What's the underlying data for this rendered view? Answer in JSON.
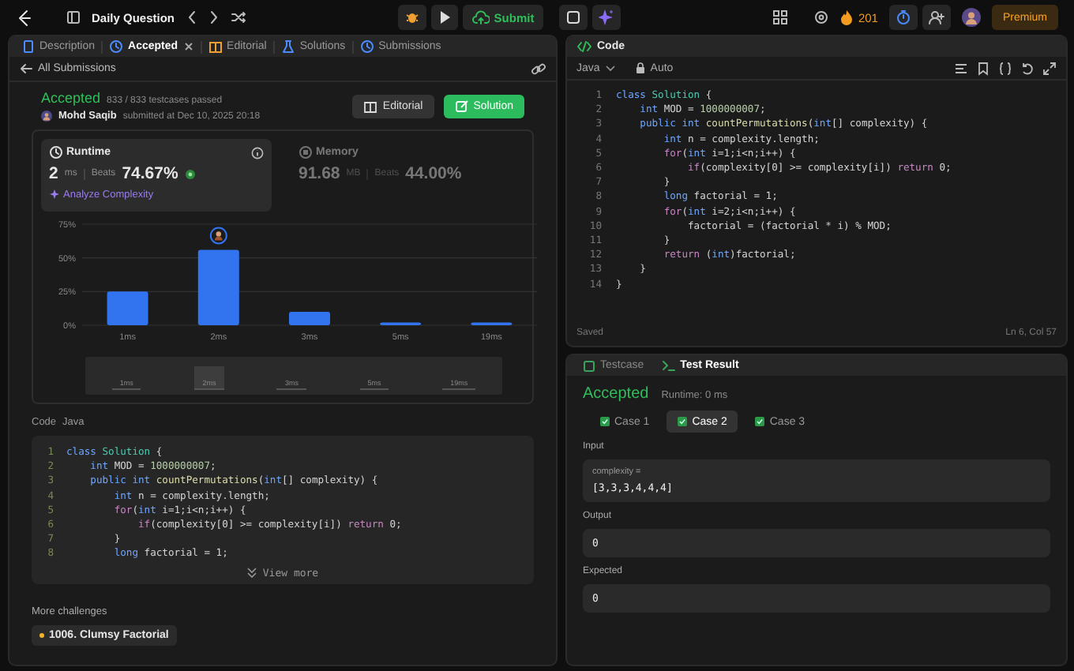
{
  "top_bar": {
    "title": "Daily Question",
    "submit": "Submit",
    "streak": "201",
    "premium": "Premium"
  },
  "tabs": [
    {
      "label": "Description",
      "kind": "description",
      "selected": false,
      "closable": false
    },
    {
      "label": "Accepted",
      "kind": "accepted",
      "selected": true,
      "closable": true
    },
    {
      "label": "Editorial",
      "kind": "editorial",
      "selected": false,
      "closable": false
    },
    {
      "label": "Solutions",
      "kind": "solutions",
      "selected": false,
      "closable": false
    },
    {
      "label": "Submissions",
      "kind": "submissions",
      "selected": false,
      "closable": false
    }
  ],
  "back_link": "All Submissions",
  "submission": {
    "status": "Accepted",
    "testcases": "833 / 833 testcases passed",
    "user": "Mohd Saqib",
    "submitted": "submitted at Dec 10, 2025 20:18",
    "buttons": [
      {
        "label": "Editorial",
        "kind": "secondary"
      },
      {
        "label": "Solution",
        "kind": "primary"
      }
    ]
  },
  "stats": [
    {
      "kind": "runtime",
      "title": "Runtime",
      "value": "2",
      "unit": "ms",
      "beats_label": "Beats",
      "beats": "74.67%",
      "selected": true,
      "link": "Analyze Complexity"
    },
    {
      "kind": "memory",
      "title": "Memory",
      "value": "91.68",
      "unit": "MB",
      "beats_label": "Beats",
      "beats": "44.00%",
      "selected": false
    }
  ],
  "runtime_chart": {
    "chart_data": {
      "type": "bar",
      "categories": [
        "1ms",
        "2ms",
        "3ms",
        "5ms",
        "19ms"
      ],
      "values": [
        25,
        56,
        10,
        2,
        2
      ],
      "ylim": [
        0,
        75
      ],
      "yticks": [
        {
          "value": 0,
          "label": "0%"
        },
        {
          "value": 25,
          "label": "25%"
        },
        {
          "value": 50,
          "label": "50%"
        },
        {
          "value": 75,
          "label": "75%"
        }
      ]
    }
  },
  "overview": [
    {
      "label": "1ms",
      "selected": false
    },
    {
      "label": "2ms",
      "selected": true
    },
    {
      "label": "3ms",
      "selected": false
    },
    {
      "label": "5ms",
      "selected": false
    },
    {
      "label": "19ms",
      "selected": false
    }
  ],
  "code_preview": {
    "label": "Code",
    "language": "Java",
    "more": "View more",
    "lines": [
      {
        "n": "1",
        "tokens": [
          {
            "text": "class ",
            "kind": "keyword"
          },
          {
            "text": "Solution",
            "kind": "type"
          },
          {
            "text": " {",
            "kind": "plain"
          }
        ]
      },
      {
        "n": "2",
        "tokens": [
          {
            "text": "    int ",
            "kind": "keyword"
          },
          {
            "text": "MOD = ",
            "kind": "plain"
          },
          {
            "text": "1000000007",
            "kind": "number"
          },
          {
            "text": ";",
            "kind": "plain"
          }
        ]
      },
      {
        "n": "3",
        "tokens": [
          {
            "text": "    public int ",
            "kind": "keyword"
          },
          {
            "text": "countPermutations",
            "kind": "function"
          },
          {
            "text": "(",
            "kind": "plain"
          },
          {
            "text": "int",
            "kind": "keyword"
          },
          {
            "text": "[] complexity) {",
            "kind": "plain"
          }
        ]
      },
      {
        "n": "4",
        "tokens": [
          {
            "text": "        int ",
            "kind": "keyword"
          },
          {
            "text": "n = complexity.length;",
            "kind": "plain"
          }
        ]
      },
      {
        "n": "5",
        "tokens": [
          {
            "text": "        for",
            "kind": "control"
          },
          {
            "text": "(",
            "kind": "plain"
          },
          {
            "text": "int ",
            "kind": "keyword"
          },
          {
            "text": "i=1;i<n;i++) {",
            "kind": "plain"
          }
        ]
      },
      {
        "n": "6",
        "tokens": [
          {
            "text": "            if",
            "kind": "control"
          },
          {
            "text": "(complexity[0] >= complexity[i]) ",
            "kind": "plain"
          },
          {
            "text": "return ",
            "kind": "control"
          },
          {
            "text": "0;",
            "kind": "plain"
          }
        ]
      },
      {
        "n": "7",
        "tokens": [
          {
            "text": "        }",
            "kind": "plain"
          }
        ]
      },
      {
        "n": "8",
        "tokens": [
          {
            "text": "        long ",
            "kind": "keyword"
          },
          {
            "text": "factorial = 1;",
            "kind": "plain"
          }
        ]
      }
    ]
  },
  "more_challenges": {
    "title": "More challenges",
    "items": [
      "1006. Clumsy Factorial"
    ]
  },
  "editor": {
    "title": "Code",
    "language": "Java",
    "mode": "Auto",
    "saved": "Saved",
    "position": "Ln 6, Col 57",
    "lines": [
      {
        "n": "1",
        "tokens": [
          {
            "text": "class ",
            "kind": "keyword"
          },
          {
            "text": "Solution",
            "kind": "type"
          },
          {
            "text": " {",
            "kind": "plain"
          }
        ]
      },
      {
        "n": "2",
        "tokens": [
          {
            "text": "    int ",
            "kind": "keyword"
          },
          {
            "text": "MOD = ",
            "kind": "plain"
          },
          {
            "text": "1000000007",
            "kind": "number"
          },
          {
            "text": ";",
            "kind": "plain"
          }
        ]
      },
      {
        "n": "3",
        "tokens": [
          {
            "text": "    public int ",
            "kind": "keyword"
          },
          {
            "text": "countPermutations",
            "kind": "function"
          },
          {
            "text": "(",
            "kind": "plain"
          },
          {
            "text": "int",
            "kind": "keyword"
          },
          {
            "text": "[] complexity) {",
            "kind": "plain"
          }
        ]
      },
      {
        "n": "4",
        "tokens": [
          {
            "text": "        int ",
            "kind": "keyword"
          },
          {
            "text": "n = complexity.length;",
            "kind": "plain"
          }
        ]
      },
      {
        "n": "5",
        "tokens": [
          {
            "text": "        for",
            "kind": "control"
          },
          {
            "text": "(",
            "kind": "plain"
          },
          {
            "text": "int ",
            "kind": "keyword"
          },
          {
            "text": "i=1;i<n;i++) {",
            "kind": "plain"
          }
        ]
      },
      {
        "n": "6",
        "tokens": [
          {
            "text": "            if",
            "kind": "control"
          },
          {
            "text": "(complexity[0] >= complexity[i]) ",
            "kind": "plain"
          },
          {
            "text": "return ",
            "kind": "control"
          },
          {
            "text": "0;",
            "kind": "plain"
          }
        ]
      },
      {
        "n": "7",
        "tokens": [
          {
            "text": "        }",
            "kind": "plain"
          }
        ]
      },
      {
        "n": "8",
        "tokens": [
          {
            "text": "        long ",
            "kind": "keyword"
          },
          {
            "text": "factorial = 1;",
            "kind": "plain"
          }
        ]
      },
      {
        "n": "9",
        "tokens": [
          {
            "text": "        for",
            "kind": "control"
          },
          {
            "text": "(",
            "kind": "plain"
          },
          {
            "text": "int ",
            "kind": "keyword"
          },
          {
            "text": "i=2;i<n;i++) {",
            "kind": "plain"
          }
        ]
      },
      {
        "n": "10",
        "tokens": [
          {
            "text": "            factorial = (factorial * i) % MOD;",
            "kind": "plain"
          }
        ]
      },
      {
        "n": "11",
        "tokens": [
          {
            "text": "        }",
            "kind": "plain"
          }
        ]
      },
      {
        "n": "12",
        "tokens": [
          {
            "text": "        return ",
            "kind": "control"
          },
          {
            "text": "(",
            "kind": "plain"
          },
          {
            "text": "int",
            "kind": "keyword"
          },
          {
            "text": ")factorial;",
            "kind": "plain"
          }
        ]
      },
      {
        "n": "13",
        "tokens": [
          {
            "text": "    }",
            "kind": "plain"
          }
        ]
      },
      {
        "n": "14",
        "tokens": [
          {
            "text": "}",
            "kind": "plain"
          }
        ]
      }
    ]
  },
  "result": {
    "tabs": [
      {
        "label": "Testcase",
        "kind": "testcase",
        "selected": false
      },
      {
        "label": "Test Result",
        "kind": "result",
        "selected": true
      }
    ],
    "status": "Accepted",
    "runtime": "Runtime: 0 ms",
    "cases": [
      {
        "label": "Case 1",
        "selected": false
      },
      {
        "label": "Case 2",
        "selected": true
      },
      {
        "label": "Case 3",
        "selected": false
      }
    ],
    "fields": [
      {
        "label": "Input",
        "name": "complexity =",
        "value": "[3,3,3,4,4,4]"
      },
      {
        "label": "Output",
        "value": "0"
      },
      {
        "label": "Expected",
        "value": "0"
      }
    ]
  }
}
